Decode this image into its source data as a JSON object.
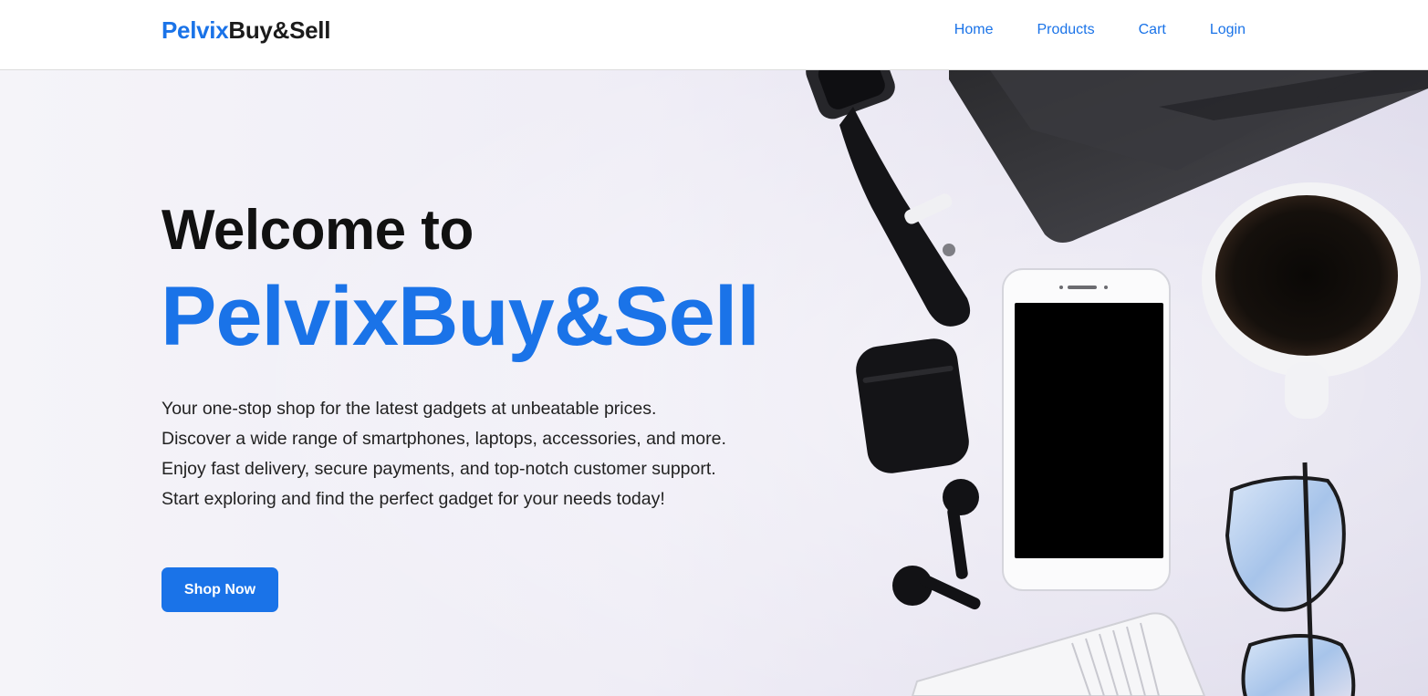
{
  "nav": {
    "brand_part1": "Pelvix",
    "brand_part2": "Buy&Sell",
    "links": [
      "Home",
      "Products",
      "Cart",
      "Login"
    ]
  },
  "hero": {
    "welcome": "Welcome to",
    "brand_name": "PelvixBuy&Sell",
    "description": "Your one-stop shop for the latest gadgets at unbeatable prices. Discover a wide range of smartphones, laptops, accessories, and more. Enjoy fast delivery, secure payments, and top-notch customer support. Start exploring and find the perfect gadget for your needs today!",
    "cta_label": "Shop Now",
    "image_description": "flat-lay-gadgets-photo"
  },
  "colors": {
    "accent": "#1a73e8",
    "text_dark": "#111111",
    "nav_bg": "#ffffff"
  }
}
